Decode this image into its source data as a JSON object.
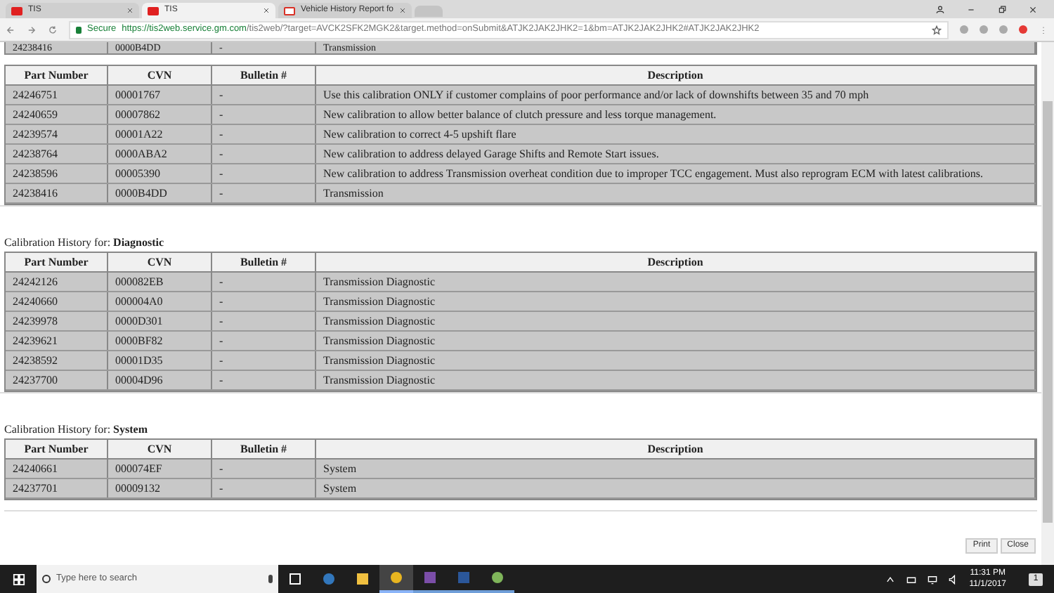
{
  "browser": {
    "tabs": [
      {
        "label": "TIS",
        "selected": false
      },
      {
        "label": "TIS",
        "selected": true
      },
      {
        "label": "Vehicle History Report fo",
        "selected": false
      }
    ],
    "address": {
      "secure_label": "Secure",
      "host": "https://tis2web.service.gm.com",
      "path": "/tis2web/?target=AVCK2SFK2MGK2&target.method=onSubmit&ATJK2JAK2JHK2=1&bm=ATJK2JAK2JHK2#ATJK2JAK2JHK2"
    }
  },
  "cut_row": [
    "24238416",
    "0000B4DD",
    "-",
    "Transmission"
  ],
  "sections": [
    {
      "columns": [
        "Part Number",
        "CVN",
        "Bulletin #",
        "Description"
      ],
      "rows": [
        [
          "24246751",
          "00001767",
          "-",
          "Use this calibration ONLY if customer complains of poor performance and/or lack of downshifts between 35 and 70 mph"
        ],
        [
          "24240659",
          "00007862",
          "-",
          "New calibration to allow better balance of clutch pressure and less torque management."
        ],
        [
          "24239574",
          "00001A22",
          "-",
          "New calibration to correct 4-5 upshift flare"
        ],
        [
          "24238764",
          "0000ABA2",
          "-",
          "New calibration to address delayed Garage Shifts and Remote Start issues."
        ],
        [
          "24238596",
          "00005390",
          "-",
          "New calibration to address Transmission overheat condition due to improper TCC engagement. Must also reprogram ECM with latest calibrations."
        ],
        [
          "24238416",
          "0000B4DD",
          "-",
          "Transmission"
        ]
      ]
    },
    {
      "title_prefix": "Calibration History for:",
      "title": "Diagnostic",
      "columns": [
        "Part Number",
        "CVN",
        "Bulletin #",
        "Description"
      ],
      "rows": [
        [
          "24242126",
          "000082EB",
          "-",
          "Transmission Diagnostic"
        ],
        [
          "24240660",
          "000004A0",
          "-",
          "Transmission Diagnostic"
        ],
        [
          "24239978",
          "0000D301",
          "-",
          "Transmission Diagnostic"
        ],
        [
          "24239621",
          "0000BF82",
          "-",
          "Transmission Diagnostic"
        ],
        [
          "24238592",
          "00001D35",
          "-",
          "Transmission Diagnostic"
        ],
        [
          "24237700",
          "00004D96",
          "-",
          "Transmission Diagnostic"
        ]
      ]
    },
    {
      "title_prefix": "Calibration History for:",
      "title": "System",
      "columns": [
        "Part Number",
        "CVN",
        "Bulletin #",
        "Description"
      ],
      "rows": [
        [
          "24240661",
          "000074EF",
          "-",
          "System"
        ],
        [
          "24237701",
          "00009132",
          "-",
          "System"
        ]
      ]
    }
  ],
  "buttons": [
    "Print",
    "Close"
  ],
  "taskbar": {
    "search_placeholder": "Type here to search",
    "time": "11:31 PM",
    "date": "11/1/2017",
    "notifications": "1"
  }
}
